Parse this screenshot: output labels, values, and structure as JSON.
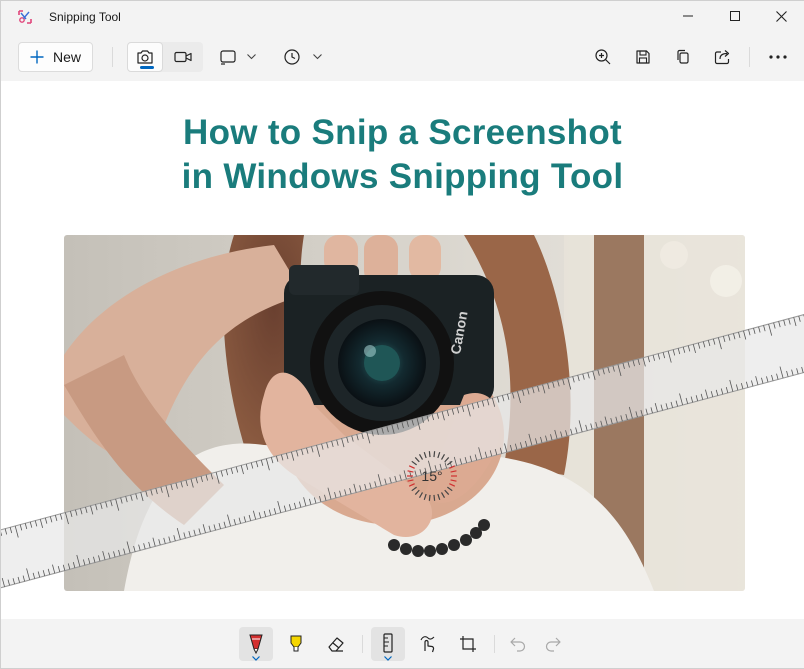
{
  "window": {
    "title": "Snipping Tool",
    "controls": [
      "minimize",
      "maximize",
      "close"
    ]
  },
  "toolbar": {
    "new_label": "New",
    "mode_buttons": [
      {
        "name": "snip-mode-button",
        "icon": "camera-icon",
        "active": true
      },
      {
        "name": "record-mode-button",
        "icon": "video-camera-icon",
        "active": false
      }
    ],
    "dropdowns": [
      {
        "name": "snip-shape-dropdown",
        "icon": "rectangle-snip-icon"
      },
      {
        "name": "delay-dropdown",
        "icon": "clock-icon"
      }
    ],
    "right_icons": [
      "zoom-in-icon",
      "save-icon",
      "copy-icon",
      "share-icon",
      "more-icon"
    ]
  },
  "canvas": {
    "headline_line1": "How to Snip a Screenshot",
    "headline_line2": "in Windows Snipping Tool",
    "photo_subject": "camera-photo",
    "camera_brand": "Canon"
  },
  "ruler": {
    "angle_label": "15°",
    "angle_degrees": 15
  },
  "annotation_tools": [
    {
      "name": "ballpoint-pen-button",
      "icon": "pen-icon",
      "color": "#d32f2f",
      "selected": true
    },
    {
      "name": "highlighter-button",
      "icon": "highlighter-icon",
      "color": "#f5d600",
      "selected": false
    },
    {
      "name": "eraser-button",
      "icon": "eraser-icon",
      "selected": false
    },
    {
      "name": "ruler-button",
      "icon": "ruler-icon",
      "selected": true
    },
    {
      "name": "touch-writing-button",
      "icon": "touch-writing-icon",
      "selected": false
    },
    {
      "name": "crop-button",
      "icon": "crop-icon",
      "selected": false
    },
    {
      "name": "undo-button",
      "icon": "undo-icon",
      "enabled": false
    },
    {
      "name": "redo-button",
      "icon": "redo-icon",
      "enabled": false
    }
  ],
  "colors": {
    "accent": "#0067c0",
    "headline": "#1a7c7c",
    "pen_red": "#d32f2f",
    "highlighter_yellow": "#f5d600"
  }
}
